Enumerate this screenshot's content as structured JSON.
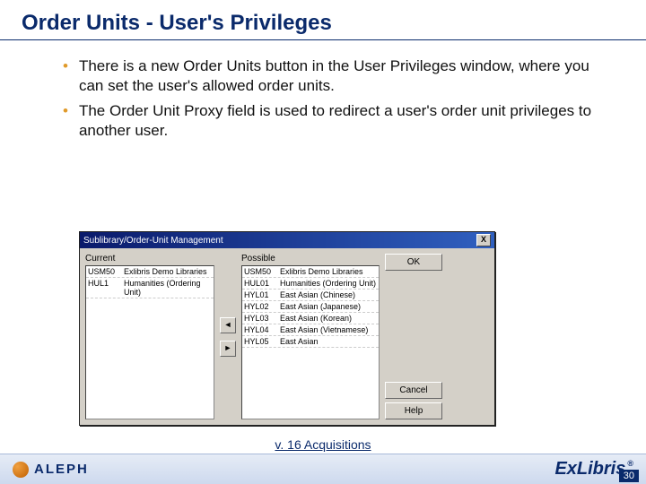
{
  "title": "Order Units - User's Privileges",
  "bullets": [
    "There is a new Order Units button in the User Privileges window, where you can set the user's allowed order units.",
    "The Order Unit Proxy field is used to redirect a user's order unit privileges to another user."
  ],
  "dialog": {
    "title": "Sublibrary/Order-Unit Management",
    "currentLabel": "Current",
    "possibleLabel": "Possible",
    "current": [
      {
        "code": "USM50",
        "desc": "Exlibris Demo Libraries"
      },
      {
        "code": "HUL1",
        "desc": "Humanities (Ordering Unit)"
      }
    ],
    "possible": [
      {
        "code": "USM50",
        "desc": "Exlibris Demo Libraries"
      },
      {
        "code": "HUL01",
        "desc": "Humanities (Ordering Unit)"
      },
      {
        "code": "HYL01",
        "desc": "East Asian (Chinese)"
      },
      {
        "code": "HYL02",
        "desc": "East Asian (Japanese)"
      },
      {
        "code": "HYL03",
        "desc": "East Asian (Korean)"
      },
      {
        "code": "HYL04",
        "desc": "East Asian (Vietnamese)"
      },
      {
        "code": "HYL05",
        "desc": "East Asian"
      }
    ],
    "ok": "OK",
    "cancel": "Cancel",
    "help": "Help",
    "arrowLeft": "◄",
    "arrowRight": "►",
    "close": "X"
  },
  "footer": {
    "center": "v. 16 Acquisitions",
    "aleph": "ALEPH",
    "exlibris": "ExLibris",
    "reg": "®",
    "page": "30"
  }
}
